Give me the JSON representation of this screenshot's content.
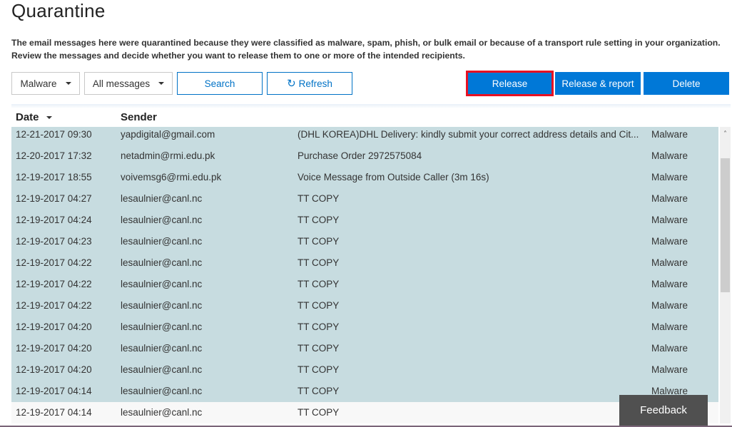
{
  "page": {
    "title": "Quarantine",
    "description_line1": "The email messages here were quarantined because they were classified as malware, spam, phish, or bulk email or because of a transport rule setting in your organization.",
    "description_line2": "Review the messages and decide whether you want to release them to one or more of the intended recipients."
  },
  "toolbar": {
    "type_filter": "Malware",
    "message_filter": "All messages",
    "search_label": "Search",
    "refresh_label": "Refresh",
    "release_label": "Release",
    "release_report_label": "Release & report",
    "delete_label": "Delete"
  },
  "grid": {
    "columns": {
      "date": "Date",
      "sender": "Sender"
    },
    "rows": [
      {
        "date": "12-21-2017 09:30",
        "sender": "yapdigital@gmail.com",
        "subject": "(DHL KOREA)DHL Delivery: kindly submit your correct address details and Cit...",
        "type": "Malware",
        "selected": true
      },
      {
        "date": "12-20-2017 17:32",
        "sender": "netadmin@rmi.edu.pk",
        "subject": "Purchase Order 2972575084",
        "type": "Malware",
        "selected": true
      },
      {
        "date": "12-19-2017 18:55",
        "sender": "voivemsg6@rmi.edu.pk",
        "subject": "Voice Message from Outside Caller (3m 16s)",
        "type": "Malware",
        "selected": true
      },
      {
        "date": "12-19-2017 04:27",
        "sender": "lesaulnier@canl.nc",
        "subject": "TT COPY",
        "type": "Malware",
        "selected": true
      },
      {
        "date": "12-19-2017 04:24",
        "sender": "lesaulnier@canl.nc",
        "subject": "TT COPY",
        "type": "Malware",
        "selected": true
      },
      {
        "date": "12-19-2017 04:23",
        "sender": "lesaulnier@canl.nc",
        "subject": "TT COPY",
        "type": "Malware",
        "selected": true
      },
      {
        "date": "12-19-2017 04:22",
        "sender": "lesaulnier@canl.nc",
        "subject": "TT COPY",
        "type": "Malware",
        "selected": true
      },
      {
        "date": "12-19-2017 04:22",
        "sender": "lesaulnier@canl.nc",
        "subject": "TT COPY",
        "type": "Malware",
        "selected": true
      },
      {
        "date": "12-19-2017 04:22",
        "sender": "lesaulnier@canl.nc",
        "subject": "TT COPY",
        "type": "Malware",
        "selected": true
      },
      {
        "date": "12-19-2017 04:20",
        "sender": "lesaulnier@canl.nc",
        "subject": "TT COPY",
        "type": "Malware",
        "selected": true
      },
      {
        "date": "12-19-2017 04:20",
        "sender": "lesaulnier@canl.nc",
        "subject": "TT COPY",
        "type": "Malware",
        "selected": true
      },
      {
        "date": "12-19-2017 04:20",
        "sender": "lesaulnier@canl.nc",
        "subject": "TT COPY",
        "type": "Malware",
        "selected": true
      },
      {
        "date": "12-19-2017 04:14",
        "sender": "lesaulnier@canl.nc",
        "subject": "TT COPY",
        "type": "Malware",
        "selected": true
      },
      {
        "date": "12-19-2017 04:14",
        "sender": "lesaulnier@canl.nc",
        "subject": "TT COPY",
        "type": "",
        "selected": false
      }
    ]
  },
  "feedback": {
    "label": "Feedback"
  },
  "colors": {
    "accent": "#0078d7",
    "selected_row": "#c7dce0",
    "highlight_border": "#e81123",
    "feedback_bg": "#505050"
  }
}
